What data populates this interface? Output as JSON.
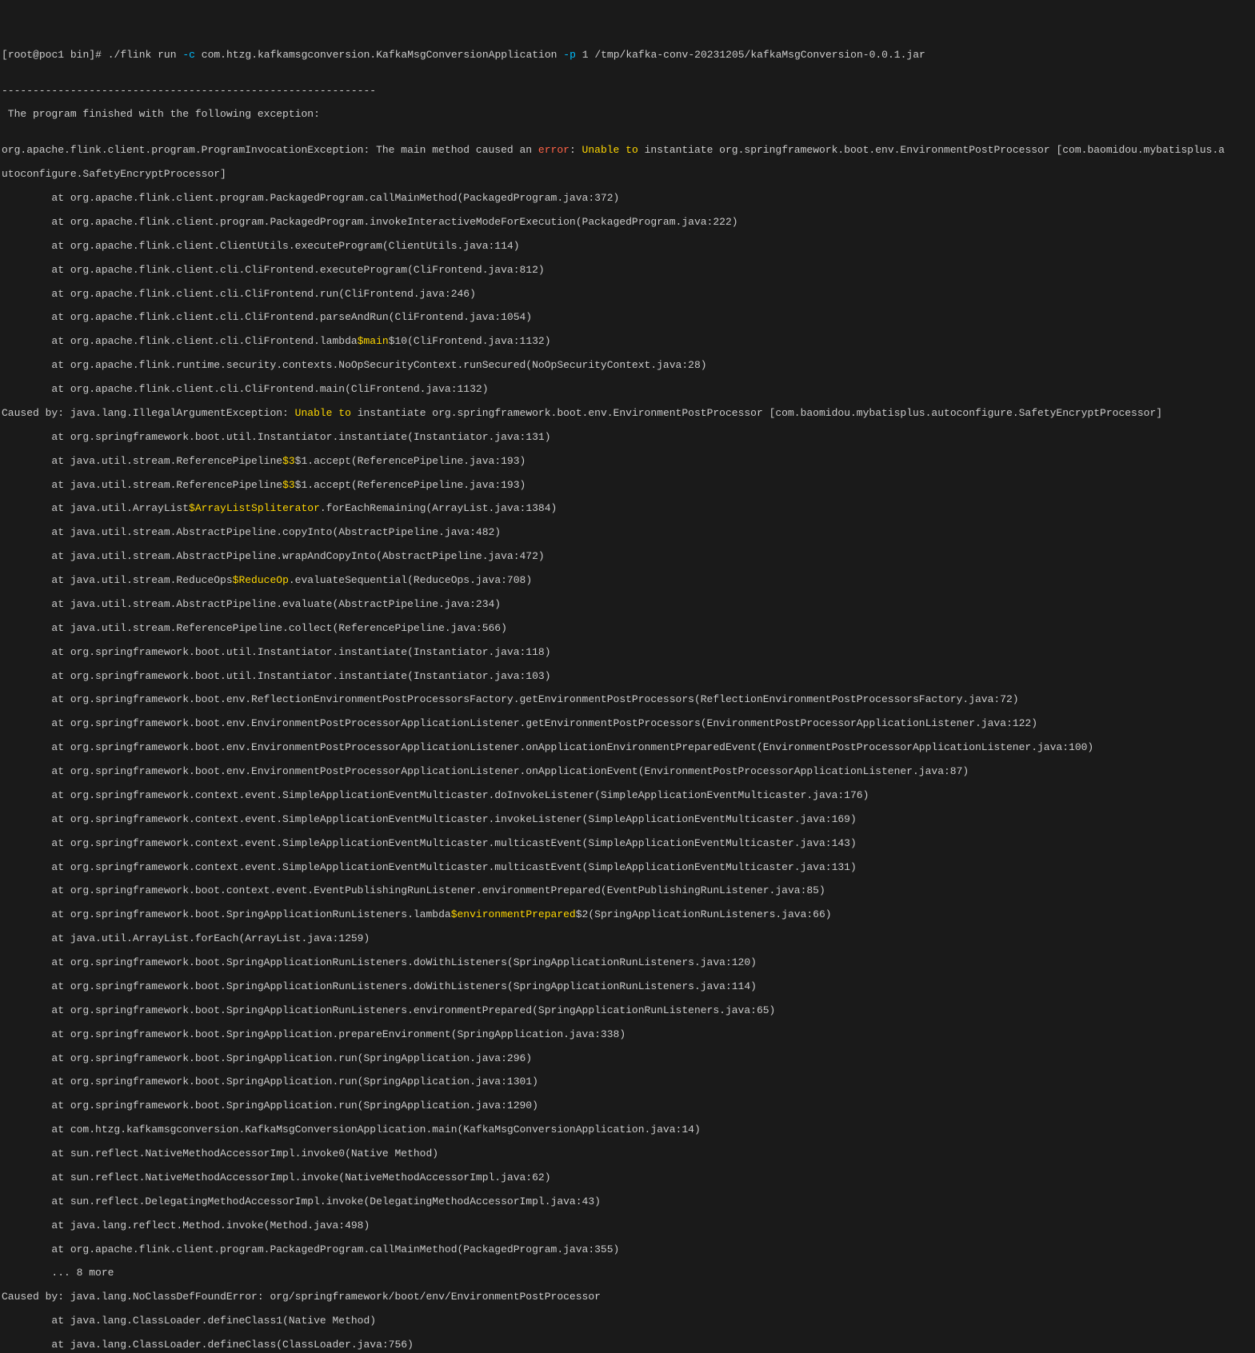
{
  "prompt": {
    "user": "root",
    "host": "poc1",
    "path": "bin",
    "symbol": "#"
  },
  "command": {
    "exe": "./flink run",
    "flag_c": "-c",
    "class": "com.htzg.kafkamsgconversion.KafkaMsgConversionApplication",
    "flag_p": "-p",
    "parallelism": "1",
    "jar": "/tmp/kafka-conv-20231205/kafkaMsgConversion-0.0.1.jar"
  },
  "separator": "------------------------------------------------------------",
  "intro": " The program finished with the following exception:",
  "blank": "",
  "exception_head": {
    "prefix": "org.apache.flink.client.program.ProgramInvocationException: The main method caused an ",
    "error": "error",
    "colon": ": ",
    "unable": "Unable to",
    "rest": " instantiate org.springframework.boot.env.EnvironmentPostProcessor [com.baomidou.mybatisplus.a",
    "line2": "utoconfigure.SafetyEncryptProcessor]"
  },
  "stack1": [
    "        at org.apache.flink.client.program.PackagedProgram.callMainMethod(PackagedProgram.java:372)",
    "        at org.apache.flink.client.program.PackagedProgram.invokeInteractiveModeForExecution(PackagedProgram.java:222)",
    "        at org.apache.flink.client.ClientUtils.executeProgram(ClientUtils.java:114)",
    "        at org.apache.flink.client.cli.CliFrontend.executeProgram(CliFrontend.java:812)",
    "        at org.apache.flink.client.cli.CliFrontend.run(CliFrontend.java:246)",
    "        at org.apache.flink.client.cli.CliFrontend.parseAndRun(CliFrontend.java:1054)"
  ],
  "stack1_lambda": {
    "pre": "        at org.apache.flink.client.cli.CliFrontend.lambda",
    "hl": "$main",
    "post": "$10(CliFrontend.java:1132)"
  },
  "stack1b": [
    "        at org.apache.flink.runtime.security.contexts.NoOpSecurityContext.runSecured(NoOpSecurityContext.java:28)",
    "        at org.apache.flink.client.cli.CliFrontend.main(CliFrontend.java:1132)"
  ],
  "caused1": {
    "pre": "Caused by: java.lang.IllegalArgumentException: ",
    "unable": "Unable to",
    "post": " instantiate org.springframework.boot.env.EnvironmentPostProcessor [com.baomidou.mybatisplus.autoconfigure.SafetyEncryptProcessor]"
  },
  "stack2a": [
    "        at org.springframework.boot.util.Instantiator.instantiate(Instantiator.java:131)"
  ],
  "stack2_ref1": {
    "pre": "        at java.util.stream.ReferencePipeline",
    "hl": "$3",
    "post": "$1.accept(ReferencePipeline.java:193)"
  },
  "stack2_ref2": {
    "pre": "        at java.util.stream.ReferencePipeline",
    "hl": "$3",
    "post": "$1.accept(ReferencePipeline.java:193)"
  },
  "stack2_arraylist": {
    "pre": "        at java.util.ArrayList",
    "hl": "$ArrayListSpliterator",
    "post": ".forEachRemaining(ArrayList.java:1384)"
  },
  "stack2b": [
    "        at java.util.stream.AbstractPipeline.copyInto(AbstractPipeline.java:482)",
    "        at java.util.stream.AbstractPipeline.wrapAndCopyInto(AbstractPipeline.java:472)"
  ],
  "stack2_reduce": {
    "pre": "        at java.util.stream.ReduceOps",
    "hl": "$ReduceOp",
    "post": ".evaluateSequential(ReduceOps.java:708)"
  },
  "stack2c": [
    "        at java.util.stream.AbstractPipeline.evaluate(AbstractPipeline.java:234)",
    "        at java.util.stream.ReferencePipeline.collect(ReferencePipeline.java:566)",
    "        at org.springframework.boot.util.Instantiator.instantiate(Instantiator.java:118)",
    "        at org.springframework.boot.util.Instantiator.instantiate(Instantiator.java:103)",
    "        at org.springframework.boot.env.ReflectionEnvironmentPostProcessorsFactory.getEnvironmentPostProcessors(ReflectionEnvironmentPostProcessorsFactory.java:72)",
    "        at org.springframework.boot.env.EnvironmentPostProcessorApplicationListener.getEnvironmentPostProcessors(EnvironmentPostProcessorApplicationListener.java:122)",
    "        at org.springframework.boot.env.EnvironmentPostProcessorApplicationListener.onApplicationEnvironmentPreparedEvent(EnvironmentPostProcessorApplicationListener.java:100)",
    "        at org.springframework.boot.env.EnvironmentPostProcessorApplicationListener.onApplicationEvent(EnvironmentPostProcessorApplicationListener.java:87)",
    "        at org.springframework.context.event.SimpleApplicationEventMulticaster.doInvokeListener(SimpleApplicationEventMulticaster.java:176)",
    "        at org.springframework.context.event.SimpleApplicationEventMulticaster.invokeListener(SimpleApplicationEventMulticaster.java:169)",
    "        at org.springframework.context.event.SimpleApplicationEventMulticaster.multicastEvent(SimpleApplicationEventMulticaster.java:143)",
    "        at org.springframework.context.event.SimpleApplicationEventMulticaster.multicastEvent(SimpleApplicationEventMulticaster.java:131)",
    "        at org.springframework.boot.context.event.EventPublishingRunListener.environmentPrepared(EventPublishingRunListener.java:85)"
  ],
  "stack2_envprep": {
    "pre": "        at org.springframework.boot.SpringApplicationRunListeners.lambda",
    "hl": "$environmentPrepared",
    "post": "$2(SpringApplicationRunListeners.java:66)"
  },
  "stack2d": [
    "        at java.util.ArrayList.forEach(ArrayList.java:1259)",
    "        at org.springframework.boot.SpringApplicationRunListeners.doWithListeners(SpringApplicationRunListeners.java:120)",
    "        at org.springframework.boot.SpringApplicationRunListeners.doWithListeners(SpringApplicationRunListeners.java:114)",
    "        at org.springframework.boot.SpringApplicationRunListeners.environmentPrepared(SpringApplicationRunListeners.java:65)",
    "        at org.springframework.boot.SpringApplication.prepareEnvironment(SpringApplication.java:338)",
    "        at org.springframework.boot.SpringApplication.run(SpringApplication.java:296)",
    "        at org.springframework.boot.SpringApplication.run(SpringApplication.java:1301)",
    "        at org.springframework.boot.SpringApplication.run(SpringApplication.java:1290)",
    "        at com.htzg.kafkamsgconversion.KafkaMsgConversionApplication.main(KafkaMsgConversionApplication.java:14)",
    "        at sun.reflect.NativeMethodAccessorImpl.invoke0(Native Method)",
    "        at sun.reflect.NativeMethodAccessorImpl.invoke(NativeMethodAccessorImpl.java:62)",
    "        at sun.reflect.DelegatingMethodAccessorImpl.invoke(DelegatingMethodAccessorImpl.java:43)",
    "        at java.lang.reflect.Method.invoke(Method.java:498)",
    "        at org.apache.flink.client.program.PackagedProgram.callMainMethod(PackagedProgram.java:355)",
    "        ... 8 more"
  ],
  "caused2": "Caused by: java.lang.NoClassDefFoundError: org/springframework/boot/env/EnvironmentPostProcessor",
  "stack3": [
    "        at java.lang.ClassLoader.defineClass1(Native Method)",
    "        at java.lang.ClassLoader.defineClass(ClassLoader.java:756)"
  ]
}
